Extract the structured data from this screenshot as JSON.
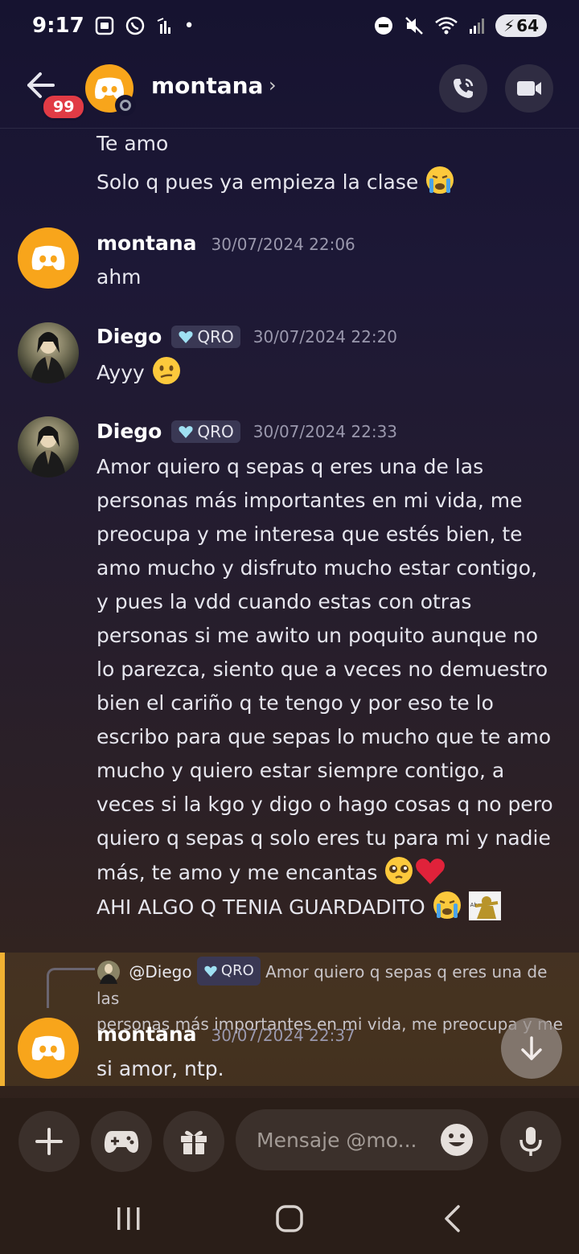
{
  "status_bar": {
    "time": "9:17",
    "battery": "64"
  },
  "header": {
    "unread_badge": "99",
    "title": "montana"
  },
  "messages": {
    "cont1": "Te amo",
    "cont2": "Solo q pues ya empieza la clase",
    "m1_author": "montana",
    "m1_time": "30/07/2024 22:06",
    "m1_text": "ahm",
    "m2_author": "Diego",
    "m2_tag": "QRO",
    "m2_time": "30/07/2024 22:20",
    "m2_text": "Ayyy",
    "m3_author": "Diego",
    "m3_tag": "QRO",
    "m3_time": "30/07/2024 22:33",
    "m3_lines": [
      "Amor quiero q sepas q eres una de las",
      "personas más importantes en mi vida, me",
      "preocupa y me interesa que estés bien, te",
      "amo mucho y disfruto mucho estar contigo,",
      "y pues la vdd cuando estas con otras",
      "personas si me awito un poquito aunque no",
      "lo parezca, siento que a veces no demuestro",
      "bien el cariño q te tengo y por eso te lo",
      "escribo para que sepas lo mucho que te amo",
      "mucho y quiero estar siempre contigo, a",
      "veces si la kgo y digo o hago cosas q no pero",
      "quiero q sepas q solo eres tu para mi y nadie",
      "más, te amo y me encantas"
    ],
    "m3_last": "AHI ALGO Q TENIA GUARDADITO",
    "sticker_label": "Abrazo"
  },
  "reply": {
    "mention": "@Diego",
    "tag": "QRO",
    "preview_line1": "Amor quiero q sepas q eres una de las",
    "preview_line2": "personas más importantes en mi vida, me preocupa y me",
    "author": "montana",
    "time": "30/07/2024 22:37",
    "text": "si amor, ntp."
  },
  "composer": {
    "placeholder": "Mensaje @mo..."
  },
  "colors": {
    "accent_yellow": "#f0b132",
    "discord_avatar": "#f8a51b",
    "badge_red": "#e13b45"
  },
  "icons": [
    "back-arrow-icon",
    "phone-icon",
    "video-icon",
    "plus-icon",
    "gamepad-icon",
    "gift-icon",
    "emoji-icon",
    "mic-icon",
    "arrow-down-icon"
  ]
}
